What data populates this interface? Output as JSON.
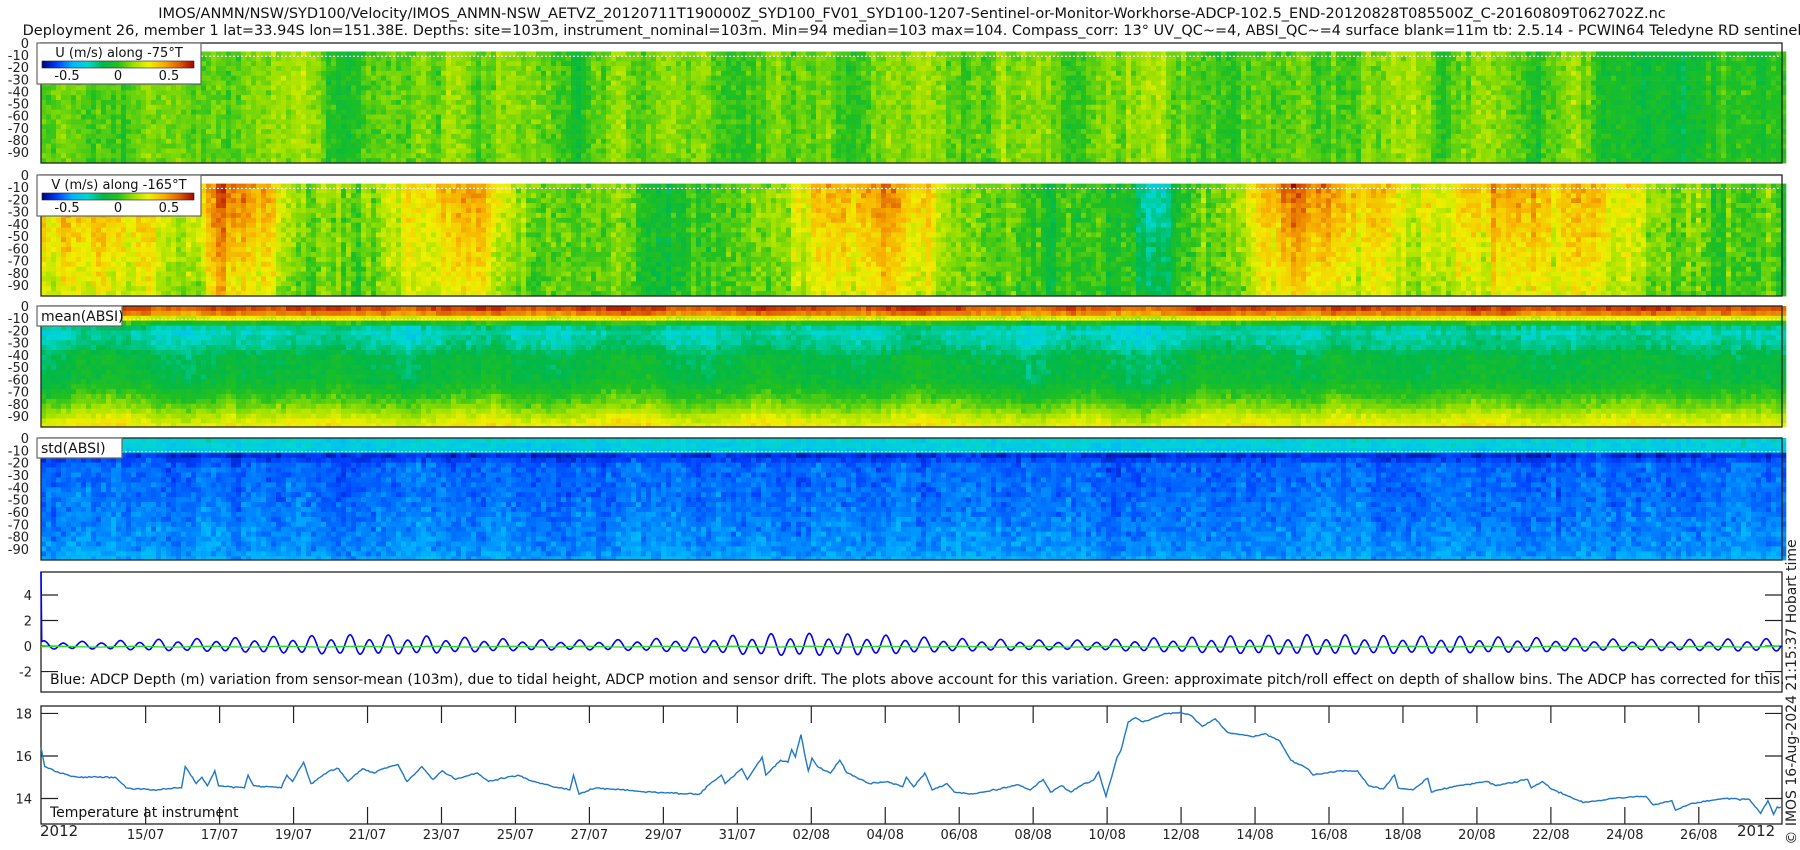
{
  "header": {
    "title_line1": "IMOS/ANMN/NSW/SYD100/Velocity/IMOS_ANMN-NSW_AETVZ_20120711T190000Z_SYD100_FV01_SYD100-1207-Sentinel-or-Monitor-Workhorse-ADCP-102.5_END-20120828T085500Z_C-20160809T062702Z.nc",
    "title_line2": "Deployment 26, member 1 lat=33.94S lon=151.38E. Depths: site=103m, instrument_nominal=103m. Min=94 median=103 max=104. Compass_corr: 13° UV_QC~=4, ABSI_QC~=4 surface blank=11m tb: 2.5.14 - PCWIN64 Teledyne RD sentinel"
  },
  "copyright": "© IMOS 16-Aug-2024 21:15:37 Hobart time",
  "colors": {
    "jet": [
      "#00007f",
      "#0040ff",
      "#00b4ff",
      "#00d8d0",
      "#00b84a",
      "#22c020",
      "#9ae000",
      "#f0f000",
      "#f8b000",
      "#e06000",
      "#a80000"
    ],
    "tide_line": "#0000ff",
    "pitch_line": "#22dd22",
    "temperature_line": "#1f77c8",
    "axis": "#222222"
  },
  "chart_data": [
    {
      "type": "heatmap",
      "id": "u",
      "legend_title": "U (m/s) along -75°T",
      "colorbar_ticks": [
        "-0.5",
        "0",
        "0.5"
      ],
      "clim": [
        -0.75,
        0.75
      ],
      "y_ticks": [
        "0",
        "-10",
        "-20",
        "-30",
        "-40",
        "-50",
        "-60",
        "-70",
        "-80",
        "-90"
      ],
      "first_bin_depth": 7,
      "surface_blank_depth": 11,
      "daily_mean": [
        0.05,
        0.1,
        0.05,
        0.15,
        0.1,
        0.05,
        0.12,
        0.15,
        0.0,
        0.05,
        0.1,
        0.15,
        0.05,
        0.1,
        0.0,
        0.05,
        0.1,
        0.15,
        0.1,
        0.05,
        0.2,
        0.1,
        0.05,
        0.1,
        0.15,
        0.05,
        0.1,
        0.1,
        0.05,
        0.15,
        0.2,
        0.05,
        0.0,
        0.05,
        0.1,
        0.05,
        0.1,
        0.2,
        0.05,
        0.1,
        0.0,
        0.15,
        0.05,
        -0.05,
        -0.12,
        0.0,
        0.05,
        0.0
      ],
      "depth_decay": 0.1,
      "noise": 0.13
    },
    {
      "type": "heatmap",
      "id": "v",
      "legend_title": "V (m/s) along -165°T",
      "colorbar_ticks": [
        "-0.5",
        "0",
        "0.5"
      ],
      "clim": [
        -0.75,
        0.75
      ],
      "y_ticks": [
        "0",
        "-10",
        "-20",
        "-30",
        "-40",
        "-50",
        "-60",
        "-70",
        "-80",
        "-90"
      ],
      "first_bin_depth": 7,
      "surface_blank_depth": 11,
      "daily_mean": [
        0.45,
        0.45,
        0.5,
        0.4,
        0.35,
        0.6,
        0.5,
        0.2,
        0.1,
        0.15,
        0.25,
        0.35,
        0.5,
        0.2,
        0.05,
        0.05,
        0.1,
        -0.05,
        0.0,
        0.05,
        0.15,
        0.4,
        0.45,
        0.5,
        0.35,
        0.05,
        0.1,
        -0.05,
        0.05,
        -0.05,
        -0.4,
        0.0,
        0.1,
        0.45,
        0.65,
        0.55,
        0.4,
        0.35,
        0.3,
        0.45,
        0.5,
        0.35,
        0.45,
        0.2,
        0.1,
        0.15,
        0.05,
        0.1
      ],
      "depth_decay": 0.45,
      "noise": 0.16
    },
    {
      "type": "heatmap",
      "id": "mean_absi",
      "legend_title": "mean(ABSI)",
      "y_ticks": [
        "0",
        "-10",
        "-20",
        "-30",
        "-40",
        "-50",
        "-60",
        "-70",
        "-80",
        "-90"
      ],
      "first_bin_depth": 0,
      "surface_blank_depth": 11,
      "profile_depths": [
        0,
        5,
        10,
        15,
        20,
        30,
        40,
        50,
        60,
        70,
        80,
        90,
        99
      ],
      "profile_norm": [
        0.9,
        0.82,
        0.55,
        0.33,
        0.3,
        0.33,
        0.4,
        0.4,
        0.42,
        0.48,
        0.55,
        0.64,
        0.7
      ],
      "daily_anomaly": [
        0,
        0.02,
        0.05,
        0.02,
        -0.02,
        0.04,
        0.0,
        0.03,
        0.05,
        0.0,
        -0.02,
        0.03,
        0.05,
        0.02,
        0.0,
        0.04,
        0.06,
        0.02,
        0.0,
        0.05,
        0.04,
        0.02,
        0.0,
        0.03,
        0.05,
        0.02,
        0.0,
        -0.02,
        0.02,
        0.0,
        -0.04,
        0.02,
        0.05,
        0.03,
        0.01,
        0.04,
        0.02,
        0.0,
        0.03,
        0.05,
        0.02,
        0.0,
        0.03,
        0.04,
        0.02,
        0.0,
        0.03,
        0.02
      ],
      "noise": 0.05
    },
    {
      "type": "heatmap",
      "id": "std_absi",
      "legend_title": "std(ABSI)",
      "y_ticks": [
        "0",
        "-10",
        "-20",
        "-30",
        "-40",
        "-50",
        "-60",
        "-70",
        "-80",
        "-90"
      ],
      "first_bin_depth": 0,
      "surface_blank_depth": 11,
      "profile_depths": [
        0,
        8,
        9,
        20,
        50,
        90,
        99
      ],
      "profile_norm": [
        0.28,
        0.26,
        0.05,
        0.13,
        0.14,
        0.17,
        0.2
      ],
      "noise": 0.05
    },
    {
      "type": "line",
      "id": "adcp_depth",
      "ylabel": "",
      "ylim": [
        -3.6,
        5.8
      ],
      "y_ticks": [
        {
          "label": "4",
          "value": 4
        },
        {
          "label": "2",
          "value": 2
        },
        {
          "label": "0",
          "value": 0
        },
        {
          "label": "-2",
          "value": -2
        }
      ],
      "caption": "Blue: ADCP Depth (m) variation from sensor-mean (103m), due to tidal height, ADCP motion and sensor drift. The plots above account for this variation. Green: approximate pitch/roll effect on depth of shallow bins. The ADCP has corrected for this.",
      "series": [
        {
          "name": "ADCP depth variation (m)",
          "color": "#0000ff",
          "tidal_period_hours": 12.42,
          "start_spike_m": 5.8,
          "daily_amplitude_m": [
            0.35,
            0.3,
            0.35,
            0.45,
            0.5,
            0.55,
            0.65,
            0.7,
            0.8,
            0.8,
            0.75,
            0.65,
            0.55,
            0.45,
            0.4,
            0.4,
            0.45,
            0.55,
            0.65,
            0.8,
            0.9,
            0.9,
            0.85,
            0.75,
            0.6,
            0.5,
            0.45,
            0.4,
            0.4,
            0.45,
            0.55,
            0.6,
            0.7,
            0.75,
            0.8,
            0.8,
            0.75,
            0.7,
            0.7,
            0.65,
            0.6,
            0.55,
            0.5,
            0.45,
            0.45,
            0.45,
            0.5,
            0.5
          ]
        },
        {
          "name": "pitch/roll effect (m)",
          "color": "#22dd22",
          "mean_m": -0.05
        }
      ]
    },
    {
      "type": "line",
      "id": "temperature",
      "label": "Temperature at instrument",
      "xunit": "days since first sample",
      "ylim": [
        12.8,
        18.35
      ],
      "y_ticks": [
        {
          "label": "18",
          "value": 18
        },
        {
          "label": "16",
          "value": 16
        },
        {
          "label": "14",
          "value": 14
        }
      ],
      "x_year_left": "2012",
      "x_year_right": "2012",
      "x_range_days": [
        0,
        47.08
      ],
      "x_ticks": [
        {
          "label": "15/07",
          "day": 2.83
        },
        {
          "label": "17/07",
          "day": 4.83
        },
        {
          "label": "19/07",
          "day": 6.83
        },
        {
          "label": "21/07",
          "day": 8.83
        },
        {
          "label": "23/07",
          "day": 10.83
        },
        {
          "label": "25/07",
          "day": 12.83
        },
        {
          "label": "27/07",
          "day": 14.83
        },
        {
          "label": "29/07",
          "day": 16.83
        },
        {
          "label": "31/07",
          "day": 18.83
        },
        {
          "label": "02/08",
          "day": 20.83
        },
        {
          "label": "04/08",
          "day": 22.83
        },
        {
          "label": "06/08",
          "day": 24.83
        },
        {
          "label": "08/08",
          "day": 26.83
        },
        {
          "label": "10/08",
          "day": 28.83
        },
        {
          "label": "12/08",
          "day": 30.83
        },
        {
          "label": "14/08",
          "day": 32.83
        },
        {
          "label": "16/08",
          "day": 34.83
        },
        {
          "label": "18/08",
          "day": 36.83
        },
        {
          "label": "20/08",
          "day": 38.83
        },
        {
          "label": "22/08",
          "day": 40.83
        },
        {
          "label": "24/08",
          "day": 42.83
        },
        {
          "label": "26/08",
          "day": 44.83
        }
      ],
      "points": [
        [
          0,
          16.4
        ],
        [
          0.1,
          15.5
        ],
        [
          0.5,
          15.2
        ],
        [
          1,
          15.0
        ],
        [
          2,
          15.0
        ],
        [
          2.3,
          14.5
        ],
        [
          3,
          14.4
        ],
        [
          3.8,
          14.5
        ],
        [
          3.9,
          15.5
        ],
        [
          4.2,
          14.7
        ],
        [
          4.35,
          15.0
        ],
        [
          4.5,
          14.6
        ],
        [
          4.7,
          15.3
        ],
        [
          4.8,
          14.6
        ],
        [
          5.5,
          14.5
        ],
        [
          5.6,
          15.1
        ],
        [
          5.75,
          14.6
        ],
        [
          6.5,
          14.5
        ],
        [
          6.65,
          15.1
        ],
        [
          6.8,
          14.8
        ],
        [
          7.1,
          15.7
        ],
        [
          7.3,
          14.7
        ],
        [
          7.8,
          15.3
        ],
        [
          8.05,
          15.4
        ],
        [
          8.3,
          14.8
        ],
        [
          8.7,
          15.4
        ],
        [
          9.0,
          15.2
        ],
        [
          9.25,
          15.4
        ],
        [
          9.65,
          15.6
        ],
        [
          9.9,
          14.8
        ],
        [
          10.3,
          15.5
        ],
        [
          10.6,
          14.9
        ],
        [
          10.85,
          15.3
        ],
        [
          11.2,
          14.9
        ],
        [
          11.8,
          15.2
        ],
        [
          12.1,
          14.8
        ],
        [
          12.9,
          15.1
        ],
        [
          13.3,
          14.8
        ],
        [
          14.0,
          14.5
        ],
        [
          14.3,
          14.4
        ],
        [
          14.4,
          15.1
        ],
        [
          14.55,
          14.2
        ],
        [
          15.0,
          14.5
        ],
        [
          16.5,
          14.3
        ],
        [
          17.8,
          14.2
        ],
        [
          18.1,
          14.7
        ],
        [
          18.4,
          15.1
        ],
        [
          18.5,
          14.7
        ],
        [
          18.95,
          15.4
        ],
        [
          19.1,
          14.9
        ],
        [
          19.5,
          15.95
        ],
        [
          19.6,
          15.1
        ],
        [
          20.0,
          15.8
        ],
        [
          20.2,
          15.7
        ],
        [
          20.3,
          16.3
        ],
        [
          20.4,
          15.95
        ],
        [
          20.55,
          17.0
        ],
        [
          20.65,
          16.1
        ],
        [
          20.75,
          15.3
        ],
        [
          20.85,
          15.9
        ],
        [
          21.0,
          15.5
        ],
        [
          21.35,
          15.2
        ],
        [
          21.6,
          15.8
        ],
        [
          21.8,
          15.2
        ],
        [
          22.4,
          14.7
        ],
        [
          22.9,
          14.8
        ],
        [
          23.3,
          14.55
        ],
        [
          23.4,
          15.0
        ],
        [
          23.6,
          14.55
        ],
        [
          23.9,
          15.2
        ],
        [
          24.1,
          14.4
        ],
        [
          24.5,
          14.7
        ],
        [
          24.7,
          14.3
        ],
        [
          25.1,
          14.2
        ],
        [
          25.8,
          14.4
        ],
        [
          26.4,
          14.65
        ],
        [
          26.75,
          14.4
        ],
        [
          27.1,
          14.9
        ],
        [
          27.3,
          14.3
        ],
        [
          27.6,
          14.6
        ],
        [
          27.85,
          14.3
        ],
        [
          28.2,
          14.7
        ],
        [
          28.45,
          14.85
        ],
        [
          28.6,
          15.25
        ],
        [
          28.8,
          14.1
        ],
        [
          29.1,
          15.95
        ],
        [
          29.2,
          16.25
        ],
        [
          29.4,
          17.6
        ],
        [
          29.6,
          17.8
        ],
        [
          29.8,
          17.6
        ],
        [
          30.4,
          18.0
        ],
        [
          30.8,
          18.05
        ],
        [
          31.1,
          17.9
        ],
        [
          31.4,
          17.4
        ],
        [
          31.75,
          17.75
        ],
        [
          32.1,
          17.1
        ],
        [
          32.8,
          16.9
        ],
        [
          33.1,
          17.05
        ],
        [
          33.5,
          16.7
        ],
        [
          33.8,
          15.8
        ],
        [
          34.25,
          15.4
        ],
        [
          34.4,
          15.1
        ],
        [
          35.1,
          15.3
        ],
        [
          35.6,
          15.3
        ],
        [
          35.9,
          14.6
        ],
        [
          36.3,
          14.45
        ],
        [
          36.6,
          15.1
        ],
        [
          36.7,
          14.5
        ],
        [
          37.1,
          14.4
        ],
        [
          37.5,
          14.95
        ],
        [
          37.6,
          14.3
        ],
        [
          38.3,
          14.6
        ],
        [
          39.1,
          14.8
        ],
        [
          39.35,
          14.6
        ],
        [
          40.2,
          14.9
        ],
        [
          40.3,
          14.5
        ],
        [
          40.6,
          14.8
        ],
        [
          40.8,
          14.5
        ],
        [
          41.7,
          13.8
        ],
        [
          42.5,
          14.0
        ],
        [
          43.4,
          14.1
        ],
        [
          43.6,
          13.7
        ],
        [
          44.1,
          13.9
        ],
        [
          44.2,
          13.45
        ],
        [
          44.6,
          13.75
        ],
        [
          45.5,
          14.0
        ],
        [
          46.2,
          13.95
        ],
        [
          46.5,
          13.3
        ],
        [
          46.7,
          13.9
        ],
        [
          46.85,
          13.25
        ],
        [
          46.95,
          13.6
        ],
        [
          47.05,
          13.6
        ]
      ]
    }
  ]
}
